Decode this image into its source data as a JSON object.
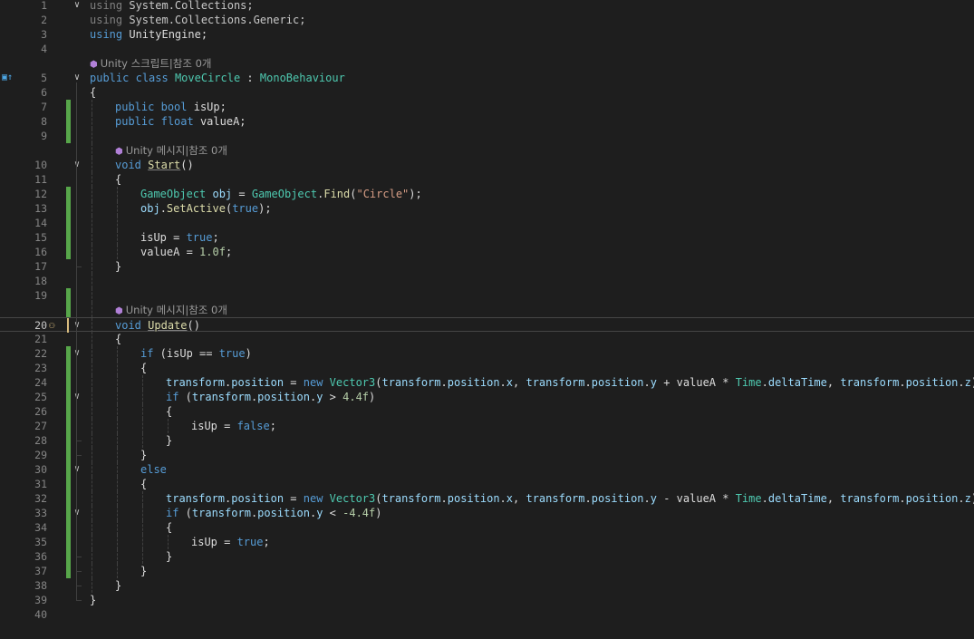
{
  "editor": {
    "colors": {
      "keyword": "#569cd6",
      "type": "#4ec9b0",
      "string": "#d69d85",
      "number": "#b5cea8",
      "variable": "#9cdcfe",
      "method": "#dcdcaa",
      "line_number": "#858585",
      "change_bar": "#57a64a"
    },
    "current_line": 20,
    "gutter": {
      "bookmark_icon": "class-bookmark-icon",
      "lightbulb_icon": "lightbulb-icon"
    },
    "lines": [
      {
        "n": "1",
        "indent": 0,
        "fold": "open",
        "tokens": [
          {
            "t": "using",
            "c": "dim"
          },
          {
            "t": " System.Collections;",
            "c": "ns"
          }
        ]
      },
      {
        "n": "2",
        "indent": 0,
        "tokens": [
          {
            "t": "using",
            "c": "dim"
          },
          {
            "t": " System.Collections.Generic;",
            "c": "ns"
          }
        ]
      },
      {
        "n": "3",
        "indent": 0,
        "tokens": [
          {
            "t": "using",
            "c": "kw"
          },
          {
            "t": " UnityEngine;",
            "c": "p"
          }
        ]
      },
      {
        "n": "4",
        "indent": 0,
        "tokens": []
      },
      {
        "lens": "Unity 스크립트|참조 0개",
        "indent": 0
      },
      {
        "n": "5",
        "indent": 0,
        "fold": "open",
        "bookmark": true,
        "tokens": [
          {
            "t": "public",
            "c": "kw"
          },
          {
            "t": " ",
            "c": "p"
          },
          {
            "t": "class",
            "c": "kw"
          },
          {
            "t": " ",
            "c": "p"
          },
          {
            "t": "MoveCircle",
            "c": "ty"
          },
          {
            "t": " : ",
            "c": "p"
          },
          {
            "t": "MonoBehaviour",
            "c": "ty"
          }
        ]
      },
      {
        "n": "6",
        "indent": 0,
        "tokens": [
          {
            "t": "{",
            "c": "p"
          }
        ]
      },
      {
        "n": "7",
        "indent": 1,
        "chg": true,
        "tokens": [
          {
            "t": "public",
            "c": "kw"
          },
          {
            "t": " ",
            "c": "p"
          },
          {
            "t": "bool",
            "c": "kw"
          },
          {
            "t": " isUp;",
            "c": "p"
          }
        ]
      },
      {
        "n": "8",
        "indent": 1,
        "chg": true,
        "tokens": [
          {
            "t": "public",
            "c": "kw"
          },
          {
            "t": " ",
            "c": "p"
          },
          {
            "t": "float",
            "c": "kw"
          },
          {
            "t": " valueA;",
            "c": "p"
          }
        ]
      },
      {
        "n": "9",
        "indent": 1,
        "chg": true,
        "tokens": []
      },
      {
        "lens": "Unity 메시지|참조 0개",
        "indent": 1
      },
      {
        "n": "10",
        "indent": 1,
        "fold": "open",
        "tokens": [
          {
            "t": "void",
            "c": "kw"
          },
          {
            "t": " ",
            "c": "p"
          },
          {
            "t": "Start",
            "c": "fnu"
          },
          {
            "t": "()",
            "c": "p"
          }
        ]
      },
      {
        "n": "11",
        "indent": 1,
        "tokens": [
          {
            "t": "{",
            "c": "p"
          }
        ]
      },
      {
        "n": "12",
        "indent": 2,
        "chg": true,
        "tokens": [
          {
            "t": "GameObject",
            "c": "ty"
          },
          {
            "t": " ",
            "c": "p"
          },
          {
            "t": "obj",
            "c": "var"
          },
          {
            "t": " = ",
            "c": "p"
          },
          {
            "t": "GameObject",
            "c": "ty"
          },
          {
            "t": ".",
            "c": "p"
          },
          {
            "t": "Find",
            "c": "fn"
          },
          {
            "t": "(",
            "c": "p"
          },
          {
            "t": "\"Circle\"",
            "c": "str"
          },
          {
            "t": ");",
            "c": "p"
          }
        ]
      },
      {
        "n": "13",
        "indent": 2,
        "chg": true,
        "tokens": [
          {
            "t": "obj",
            "c": "var"
          },
          {
            "t": ".",
            "c": "p"
          },
          {
            "t": "SetActive",
            "c": "fn"
          },
          {
            "t": "(",
            "c": "p"
          },
          {
            "t": "true",
            "c": "kw"
          },
          {
            "t": ");",
            "c": "p"
          }
        ]
      },
      {
        "n": "14",
        "indent": 2,
        "chg": true,
        "tokens": []
      },
      {
        "n": "15",
        "indent": 2,
        "chg": true,
        "tokens": [
          {
            "t": "isUp = ",
            "c": "p"
          },
          {
            "t": "true",
            "c": "kw"
          },
          {
            "t": ";",
            "c": "p"
          }
        ]
      },
      {
        "n": "16",
        "indent": 2,
        "chg": true,
        "tokens": [
          {
            "t": "valueA = ",
            "c": "p"
          },
          {
            "t": "1.0f",
            "c": "num"
          },
          {
            "t": ";",
            "c": "p"
          }
        ]
      },
      {
        "n": "17",
        "indent": 1,
        "tokens": [
          {
            "t": "}",
            "c": "p"
          }
        ]
      },
      {
        "n": "18",
        "indent": 1,
        "tokens": []
      },
      {
        "n": "19",
        "indent": 1,
        "chg": true,
        "tokens": []
      },
      {
        "lens": "Unity 메시지|참조 0개",
        "indent": 1,
        "chg": true
      },
      {
        "n": "20",
        "indent": 1,
        "fold": "open",
        "current": true,
        "bulb": true,
        "saved": true,
        "tokens": [
          {
            "t": "void",
            "c": "kw"
          },
          {
            "t": " ",
            "c": "p"
          },
          {
            "t": "Update",
            "c": "fnu"
          },
          {
            "t": "()",
            "c": "p"
          }
        ]
      },
      {
        "n": "21",
        "indent": 1,
        "tokens": [
          {
            "t": "{",
            "c": "p"
          }
        ]
      },
      {
        "n": "22",
        "indent": 2,
        "fold": "open",
        "chg": true,
        "tokens": [
          {
            "t": "if",
            "c": "kw"
          },
          {
            "t": " (isUp == ",
            "c": "p"
          },
          {
            "t": "true",
            "c": "kw"
          },
          {
            "t": ")",
            "c": "p"
          }
        ]
      },
      {
        "n": "23",
        "indent": 2,
        "chg": true,
        "tokens": [
          {
            "t": "{",
            "c": "p"
          }
        ]
      },
      {
        "n": "24",
        "indent": 3,
        "chg": true,
        "tokens": [
          {
            "t": "transform",
            "c": "var"
          },
          {
            "t": ".",
            "c": "p"
          },
          {
            "t": "position",
            "c": "var"
          },
          {
            "t": " = ",
            "c": "p"
          },
          {
            "t": "new",
            "c": "kw"
          },
          {
            "t": " ",
            "c": "p"
          },
          {
            "t": "Vector3",
            "c": "ty"
          },
          {
            "t": "(",
            "c": "p"
          },
          {
            "t": "transform",
            "c": "var"
          },
          {
            "t": ".",
            "c": "p"
          },
          {
            "t": "position",
            "c": "var"
          },
          {
            "t": ".",
            "c": "p"
          },
          {
            "t": "x",
            "c": "var"
          },
          {
            "t": ", ",
            "c": "p"
          },
          {
            "t": "transform",
            "c": "var"
          },
          {
            "t": ".",
            "c": "p"
          },
          {
            "t": "position",
            "c": "var"
          },
          {
            "t": ".",
            "c": "p"
          },
          {
            "t": "y",
            "c": "var"
          },
          {
            "t": " + valueA * ",
            "c": "p"
          },
          {
            "t": "Time",
            "c": "ty"
          },
          {
            "t": ".",
            "c": "p"
          },
          {
            "t": "deltaTime",
            "c": "var"
          },
          {
            "t": ", ",
            "c": "p"
          },
          {
            "t": "transform",
            "c": "var"
          },
          {
            "t": ".",
            "c": "p"
          },
          {
            "t": "position",
            "c": "var"
          },
          {
            "t": ".",
            "c": "p"
          },
          {
            "t": "z",
            "c": "var"
          },
          {
            "t": ");",
            "c": "p"
          }
        ]
      },
      {
        "n": "25",
        "indent": 3,
        "fold": "open",
        "chg": true,
        "tokens": [
          {
            "t": "if",
            "c": "kw"
          },
          {
            "t": " (",
            "c": "p"
          },
          {
            "t": "transform",
            "c": "var"
          },
          {
            "t": ".",
            "c": "p"
          },
          {
            "t": "position",
            "c": "var"
          },
          {
            "t": ".",
            "c": "p"
          },
          {
            "t": "y",
            "c": "var"
          },
          {
            "t": " > ",
            "c": "p"
          },
          {
            "t": "4.4f",
            "c": "num"
          },
          {
            "t": ")",
            "c": "p"
          }
        ]
      },
      {
        "n": "26",
        "indent": 3,
        "chg": true,
        "tokens": [
          {
            "t": "{",
            "c": "p"
          }
        ]
      },
      {
        "n": "27",
        "indent": 4,
        "chg": true,
        "tokens": [
          {
            "t": "isUp = ",
            "c": "p"
          },
          {
            "t": "false",
            "c": "kw"
          },
          {
            "t": ";",
            "c": "p"
          }
        ]
      },
      {
        "n": "28",
        "indent": 3,
        "chg": true,
        "tokens": [
          {
            "t": "}",
            "c": "p"
          }
        ]
      },
      {
        "n": "29",
        "indent": 2,
        "chg": true,
        "tokens": [
          {
            "t": "}",
            "c": "p"
          }
        ]
      },
      {
        "n": "30",
        "indent": 2,
        "fold": "open",
        "chg": true,
        "tokens": [
          {
            "t": "else",
            "c": "kw"
          }
        ]
      },
      {
        "n": "31",
        "indent": 2,
        "chg": true,
        "tokens": [
          {
            "t": "{",
            "c": "p"
          }
        ]
      },
      {
        "n": "32",
        "indent": 3,
        "chg": true,
        "tokens": [
          {
            "t": "transform",
            "c": "var"
          },
          {
            "t": ".",
            "c": "p"
          },
          {
            "t": "position",
            "c": "var"
          },
          {
            "t": " = ",
            "c": "p"
          },
          {
            "t": "new",
            "c": "kw"
          },
          {
            "t": " ",
            "c": "p"
          },
          {
            "t": "Vector3",
            "c": "ty"
          },
          {
            "t": "(",
            "c": "p"
          },
          {
            "t": "transform",
            "c": "var"
          },
          {
            "t": ".",
            "c": "p"
          },
          {
            "t": "position",
            "c": "var"
          },
          {
            "t": ".",
            "c": "p"
          },
          {
            "t": "x",
            "c": "var"
          },
          {
            "t": ", ",
            "c": "p"
          },
          {
            "t": "transform",
            "c": "var"
          },
          {
            "t": ".",
            "c": "p"
          },
          {
            "t": "position",
            "c": "var"
          },
          {
            "t": ".",
            "c": "p"
          },
          {
            "t": "y",
            "c": "var"
          },
          {
            "t": " - valueA * ",
            "c": "p"
          },
          {
            "t": "Time",
            "c": "ty"
          },
          {
            "t": ".",
            "c": "p"
          },
          {
            "t": "deltaTime",
            "c": "var"
          },
          {
            "t": ", ",
            "c": "p"
          },
          {
            "t": "transform",
            "c": "var"
          },
          {
            "t": ".",
            "c": "p"
          },
          {
            "t": "position",
            "c": "var"
          },
          {
            "t": ".",
            "c": "p"
          },
          {
            "t": "z",
            "c": "var"
          },
          {
            "t": ");",
            "c": "p"
          }
        ]
      },
      {
        "n": "33",
        "indent": 3,
        "fold": "open",
        "chg": true,
        "tokens": [
          {
            "t": "if",
            "c": "kw"
          },
          {
            "t": " (",
            "c": "p"
          },
          {
            "t": "transform",
            "c": "var"
          },
          {
            "t": ".",
            "c": "p"
          },
          {
            "t": "position",
            "c": "var"
          },
          {
            "t": ".",
            "c": "p"
          },
          {
            "t": "y",
            "c": "var"
          },
          {
            "t": " < ",
            "c": "p"
          },
          {
            "t": "-4.4f",
            "c": "num"
          },
          {
            "t": ")",
            "c": "p"
          }
        ]
      },
      {
        "n": "34",
        "indent": 3,
        "chg": true,
        "tokens": [
          {
            "t": "{",
            "c": "p"
          }
        ]
      },
      {
        "n": "35",
        "indent": 4,
        "chg": true,
        "tokens": [
          {
            "t": "isUp = ",
            "c": "p"
          },
          {
            "t": "true",
            "c": "kw"
          },
          {
            "t": ";",
            "c": "p"
          }
        ]
      },
      {
        "n": "36",
        "indent": 3,
        "chg": true,
        "tokens": [
          {
            "t": "}",
            "c": "p"
          }
        ]
      },
      {
        "n": "37",
        "indent": 2,
        "chg": true,
        "tokens": [
          {
            "t": "}",
            "c": "p"
          }
        ]
      },
      {
        "n": "38",
        "indent": 1,
        "tokens": [
          {
            "t": "}",
            "c": "p"
          }
        ]
      },
      {
        "n": "39",
        "indent": 0,
        "tokens": [
          {
            "t": "}",
            "c": "p"
          }
        ]
      },
      {
        "n": "40",
        "indent": 0,
        "tokens": []
      }
    ]
  }
}
